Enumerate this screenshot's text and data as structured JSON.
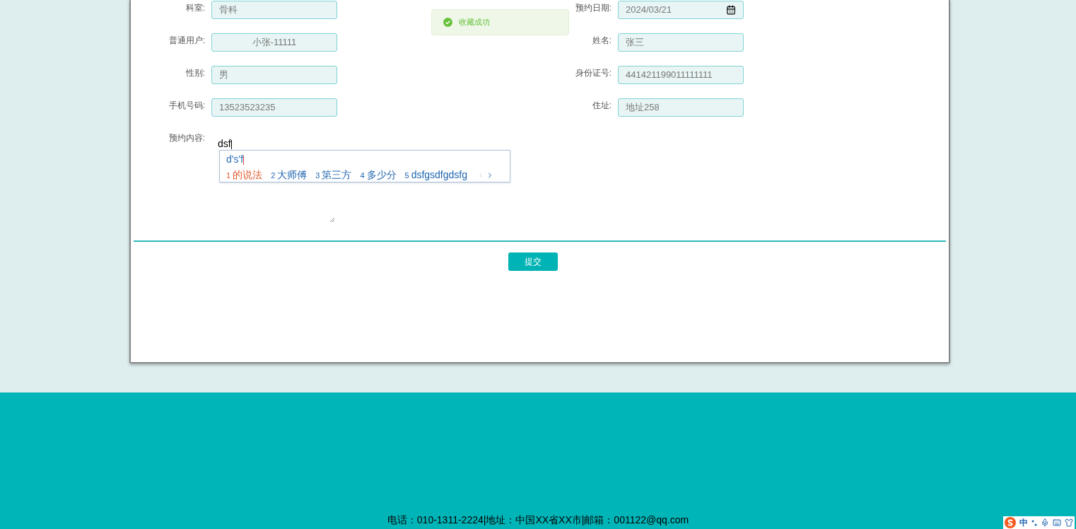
{
  "form": {
    "rows": [
      [
        {
          "label": "科室:",
          "value": "骨科",
          "kind": "text"
        },
        {
          "label": "预约日期:",
          "value": "2024/03/21",
          "kind": "date"
        }
      ],
      [
        {
          "label": "普通用户:",
          "value": "小张-11111",
          "kind": "centered"
        },
        {
          "label": "姓名:",
          "value": "张三",
          "kind": "text"
        }
      ],
      [
        {
          "label": "性别:",
          "value": "男",
          "kind": "text"
        },
        {
          "label": "身份证号:",
          "value": "441421199011111111",
          "kind": "text"
        }
      ],
      [
        {
          "label": "手机号码:",
          "value": "13523523235",
          "kind": "text"
        },
        {
          "label": "住址:",
          "value": "地址258",
          "kind": "text"
        }
      ]
    ],
    "content": {
      "label": "预约内容:",
      "value": "dsf"
    },
    "submit": "提交"
  },
  "ime": {
    "composition": "d's'f",
    "candidates": [
      {
        "index": "1",
        "text": "的说法",
        "selected": true
      },
      {
        "index": "2",
        "text": "大师傅",
        "selected": false
      },
      {
        "index": "3",
        "text": "第三方",
        "selected": false
      },
      {
        "index": "4",
        "text": "多少分",
        "selected": false
      },
      {
        "index": "5",
        "text": "dsfgsdfgdsfg",
        "selected": false
      }
    ]
  },
  "toast": {
    "message": "收藏成功"
  },
  "footer": {
    "text": "电话：010-1311-2224|地址：中国XX省XX市|邮箱：001122@qq.com"
  },
  "ime_status": {
    "mode": "中"
  }
}
